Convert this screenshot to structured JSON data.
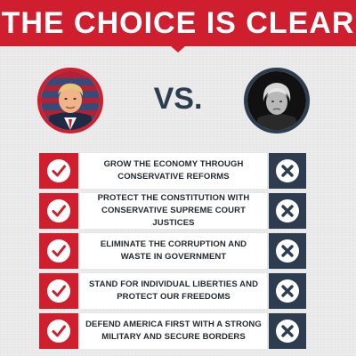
{
  "header": {
    "title": "THE CHOICE IS CLEAR"
  },
  "comparison": {
    "vs_label": "VS.",
    "left_portrait": "trump-portrait",
    "right_portrait": "clinton-portrait"
  },
  "rows": [
    {
      "line1": "GROW THE ECONOMY THROUGH",
      "line2": "CONSERVATIVE REFORMS"
    },
    {
      "line1": "PROTECT THE CONSTITUTION WITH",
      "line2": "CONSERVATIVE SUPREME COURT JUSTICES"
    },
    {
      "line1": "ELIMINATE THE CORRUPTION AND",
      "line2": "WASTE IN GOVERNMENT"
    },
    {
      "line1": "STAND FOR INDIVIDUAL LIBERTIES AND",
      "line2": "PROTECT OUR FREEDOMS"
    },
    {
      "line1": "DEFEND AMERICA FIRST WITH A STRONG",
      "line2": "MILITARY AND SECURE BORDERS"
    }
  ],
  "colors": {
    "red": "#cf1f2e",
    "navy": "#2d3d4f",
    "background": "#ececec"
  },
  "icons": {
    "check": "check-icon",
    "x": "x-icon"
  }
}
